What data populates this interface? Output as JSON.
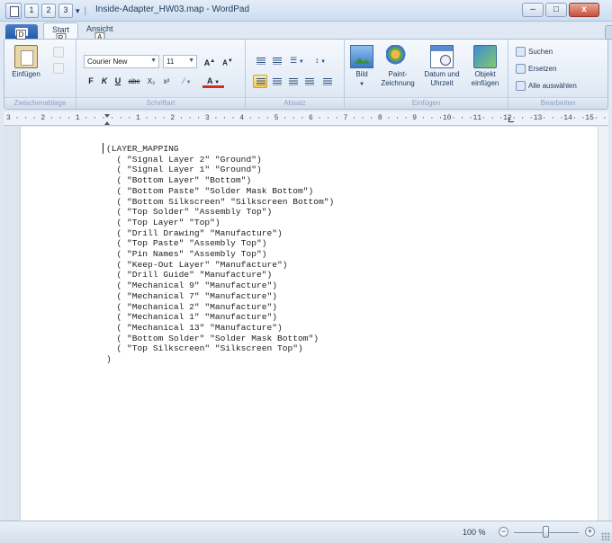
{
  "window": {
    "title": "Inside-Adapter_HW03.map - WordPad",
    "separator": "|",
    "qat_dropdown": "▾",
    "keytips": {
      "app_menu": "D",
      "qat_save": "1",
      "qat_undo": "2",
      "qat_redo": "3",
      "tab_start": "R",
      "tab_view": "A"
    },
    "controls": {
      "minimize": "–",
      "maximize": "□",
      "close": "x"
    }
  },
  "ribbon": {
    "tabs": [
      {
        "label": "Start",
        "active": true
      },
      {
        "label": "Ansicht",
        "active": false
      }
    ],
    "groups": {
      "clipboard": {
        "label": "Zwischenablage",
        "paste": "Einfügen"
      },
      "font": {
        "label": "Schriftart",
        "font_name": "Courier New",
        "font_size": "11",
        "grow": "A",
        "shrink": "A",
        "bold": "F",
        "italic": "K",
        "underline": "U",
        "strike": "abc",
        "subscript": "X₂",
        "superscript": "x²",
        "highlight": "⁄",
        "color": "A"
      },
      "paragraph": {
        "label": "Absatz",
        "list_icon": "☰",
        "spacing_icon": "↕"
      },
      "insert": {
        "label": "Einfügen",
        "picture": "Bild",
        "paint_line1": "Paint-",
        "paint_line2": "Zeichnung",
        "datetime_line1": "Datum und",
        "datetime_line2": "Uhrzeit",
        "object_line1": "Objekt",
        "object_line2": "einfügen"
      },
      "editing": {
        "label": "Bearbeiten",
        "find": "Suchen",
        "replace": "Ersetzen",
        "select_all": "Alle auswählen"
      }
    }
  },
  "ruler": {
    "text": "3 · · · 2 · · · 1 · · ·   · · · 1 · · · 2 · · · 3 · · · 4 · · · 5 · · · 6 · · · 7 · · · 8 · · · 9 · · ·10· · ·11· · ·12· · ·13· · ·14· ·15· · ·16· · ·17· ·"
  },
  "document": {
    "lines": [
      "(LAYER_MAPPING",
      "  ( \"Signal Layer 2\" \"Ground\")",
      "  ( \"Signal Layer 1\" \"Ground\")",
      "  ( \"Bottom Layer\" \"Bottom\")",
      "  ( \"Bottom Paste\" \"Solder Mask Bottom\")",
      "  ( \"Bottom Silkscreen\" \"Silkscreen Bottom\")",
      "  ( \"Top Solder\" \"Assembly Top\")",
      "  ( \"Top Layer\" \"Top\")",
      "  ( \"Drill Drawing\" \"Manufacture\")",
      "  ( \"Top Paste\" \"Assembly Top\")",
      "  ( \"Pin Names\" \"Assembly Top\")",
      "  ( \"Keep-Out Layer\" \"Manufacture\")",
      "  ( \"Drill Guide\" \"Manufacture\")",
      "  ( \"Mechanical 9\" \"Manufacture\")",
      "  ( \"Mechanical 7\" \"Manufacture\")",
      "  ( \"Mechanical 2\" \"Manufacture\")",
      "  ( \"Mechanical 1\" \"Manufacture\")",
      "  ( \"Mechanical 13\" \"Manufacture\")",
      "  ( \"Bottom Solder\" \"Solder Mask Bottom\")",
      "  ( \"Top Silkscreen\" \"Silkscreen Top\")",
      ")"
    ]
  },
  "status": {
    "zoom": "100 %",
    "zoom_out": "−",
    "zoom_in": "+",
    "zoom_level": 0.5
  },
  "colors": {
    "accent": "#1f58a8",
    "ribbon_text": "#1e395b",
    "active_paragraph": "#f7c94f"
  }
}
